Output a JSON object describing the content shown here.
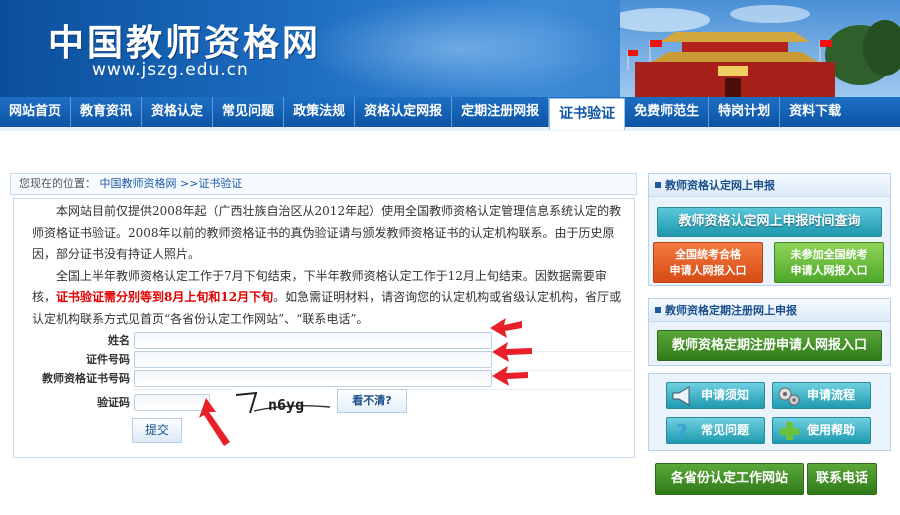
{
  "header": {
    "site_title": "中国教师资格网",
    "site_url": "www.jszg.edu.cn"
  },
  "nav": {
    "items": [
      {
        "label": "网站首页"
      },
      {
        "label": "教育资讯"
      },
      {
        "label": "资格认定"
      },
      {
        "label": "常见问题"
      },
      {
        "label": "政策法规"
      },
      {
        "label": "资格认定网报"
      },
      {
        "label": "定期注册网报"
      },
      {
        "label": "证书验证",
        "active": true
      },
      {
        "label": "免费师范生"
      },
      {
        "label": "特岗计划"
      },
      {
        "label": "资料下载"
      }
    ]
  },
  "breadcrumb": {
    "prefix": "您现在的位置：",
    "home": "中国教师资格网",
    "separator": ">>",
    "current": "证书验证"
  },
  "intro": {
    "p1": "本网站目前仅提供2008年起（广西壮族自治区从2012年起）使用全国教师资格认定管理信息系统认定的教师资格证书验证。2008年以前的教师资格证书的真伪验证请与颁发教师资格证书的认定机构联系。由于历史原因，部分证书没有持证人照片。",
    "p2_a": "全国上半年教师资格认定工作于7月下旬结束，下半年教师资格认定工作于12月上旬结束。因数据需要审核，",
    "p2_red": "证书验证需分别等到8月上旬和12月下旬",
    "p2_b": "。如急需证明材料，请咨询您的认定机构或省级认定机构，省厅或认定机构联系方式见首页“各省份认定工作网站”、“联系电话”。"
  },
  "form": {
    "name_label": "姓名",
    "id_label": "证件号码",
    "cert_label": "教师资格证书号码",
    "captcha_label": "验证码",
    "captcha_text": "n6yg",
    "unclear_label": "看不清?",
    "submit_label": "提交"
  },
  "sidebar": {
    "apply_section": {
      "title": "教师资格认定网上申报",
      "time_query": "教师资格认定网上申报时间查询",
      "passed_line1": "全国统考合格",
      "passed_line2": "申请人网报入口",
      "not_joined_line1": "未参加全国统考",
      "not_joined_line2": "申请人网报入口"
    },
    "register_section": {
      "title": "教师资格定期注册网上申报",
      "entry": "教师资格定期注册申请人网报入口"
    },
    "help": {
      "notice": "申请须知",
      "process": "申请流程",
      "faq": "常见问题",
      "usage_help": "使用帮助"
    },
    "bottom": {
      "provinces": "各省份认定工作网站",
      "contact": "联系电话"
    }
  },
  "colors": {
    "nav_blue": "#0d54a5",
    "alert_red": "#e00000",
    "arrow_red": "#e8202a"
  }
}
